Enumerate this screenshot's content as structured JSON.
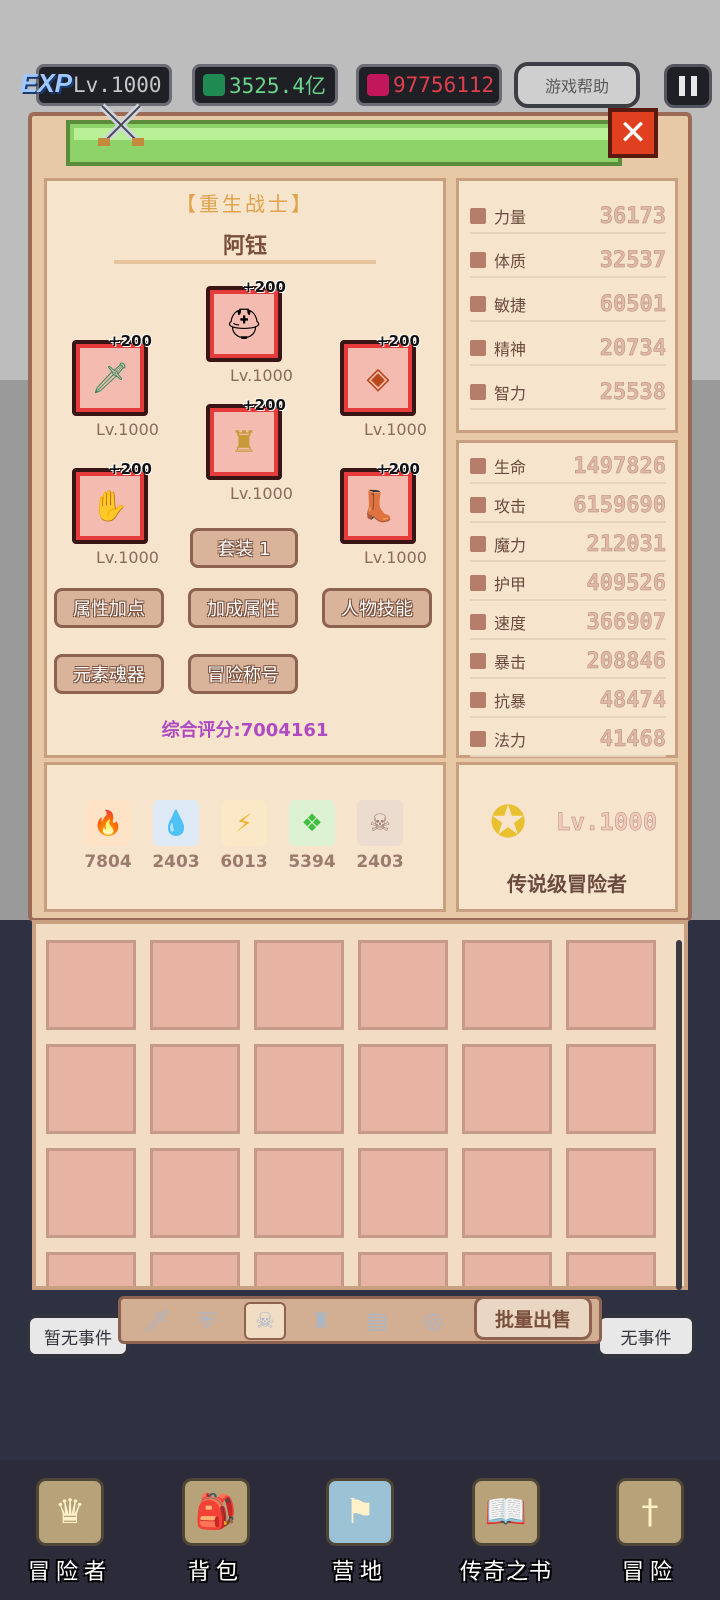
{
  "topbar": {
    "exp_badge": "EXP",
    "level": "Lv.1000",
    "green_gems": "3525.4亿",
    "red_gems": "97756112",
    "help": "游戏帮助"
  },
  "character": {
    "class_title": "【重生战士】",
    "name": "阿钰",
    "score": "综合评分:7004161"
  },
  "equipment": [
    {
      "slot": "weapon",
      "icon": "sword-icon",
      "plus": "+200",
      "level": "Lv.1000"
    },
    {
      "slot": "helmet",
      "icon": "helmet-icon",
      "plus": "+200",
      "level": "Lv.1000"
    },
    {
      "slot": "accessory",
      "icon": "amulet-icon",
      "plus": "+200",
      "level": "Lv.1000"
    },
    {
      "slot": "armor",
      "icon": "armor-icon",
      "plus": "+200",
      "level": "Lv.1000"
    },
    {
      "slot": "gloves",
      "icon": "gloves-icon",
      "plus": "+200",
      "level": "Lv.1000"
    },
    {
      "slot": "boots",
      "icon": "boots-icon",
      "plus": "+200",
      "level": "Lv.1000"
    }
  ],
  "buttons": {
    "set": "套装 1",
    "attr_points": "属性加点",
    "bonus_attr": "加成属性",
    "skills": "人物技能",
    "soul": "元素魂器",
    "titles": "冒险称号"
  },
  "base_stats": [
    {
      "label": "力量",
      "value": "36173"
    },
    {
      "label": "体质",
      "value": "32537"
    },
    {
      "label": "敏捷",
      "value": "60501"
    },
    {
      "label": "精神",
      "value": "20734"
    },
    {
      "label": "智力",
      "value": "25538"
    }
  ],
  "combat_stats": [
    {
      "label": "生命",
      "value": "1497826"
    },
    {
      "label": "攻击",
      "value": "6159690"
    },
    {
      "label": "魔力",
      "value": "212031"
    },
    {
      "label": "护甲",
      "value": "409526"
    },
    {
      "label": "速度",
      "value": "366907"
    },
    {
      "label": "暴击",
      "value": "208846"
    },
    {
      "label": "抗暴",
      "value": "48474"
    },
    {
      "label": "法力",
      "value": "41468"
    }
  ],
  "resources": [
    {
      "icon": "fire-icon",
      "value": "7804",
      "color": "#f04b1c"
    },
    {
      "icon": "water-icon",
      "value": "2403",
      "color": "#3fa0f0"
    },
    {
      "icon": "lightning-icon",
      "value": "6013",
      "color": "#f0b02a"
    },
    {
      "icon": "leaf-icon",
      "value": "5394",
      "color": "#3fbf3f"
    },
    {
      "icon": "skull-icon",
      "value": "2403",
      "color": "#9b7b6d"
    }
  ],
  "rank": {
    "level": "Lv.1000",
    "title": "传说级冒险者"
  },
  "inventory": {
    "bulk_sell": "批量出售",
    "tabs": [
      "sword-icon",
      "shield-icon",
      "skull-icon",
      "armor-icon",
      "chest-icon",
      "ring-icon"
    ]
  },
  "events": {
    "left": "暂无事件",
    "right": "无事件"
  },
  "nav": [
    {
      "icon": "helmet-icon",
      "label": "冒险者"
    },
    {
      "icon": "bag-icon",
      "label": "背包"
    },
    {
      "icon": "camp-icon",
      "label": "营地"
    },
    {
      "icon": "book-icon",
      "label": "传奇之书"
    },
    {
      "icon": "sword-icon",
      "label": "冒险"
    }
  ]
}
